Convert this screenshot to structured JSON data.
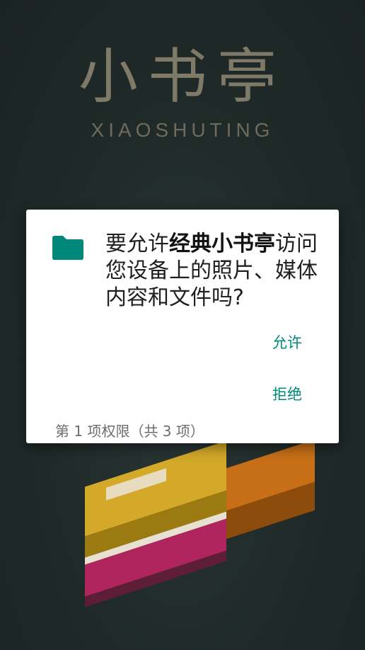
{
  "background": {
    "logo_cn": "小书亭",
    "logo_en": "XIAOSHUTING"
  },
  "dialog": {
    "icon": "folder-icon",
    "prompt_prefix": "要允许",
    "app_name": "经典小书亭",
    "prompt_suffix": "访问您设备上的照片、媒体内容和文件吗?",
    "allow_label": "允许",
    "deny_label": "拒绝",
    "counter_text": "第 1 项权限（共 3 项）",
    "accent_color": "#00897b"
  }
}
